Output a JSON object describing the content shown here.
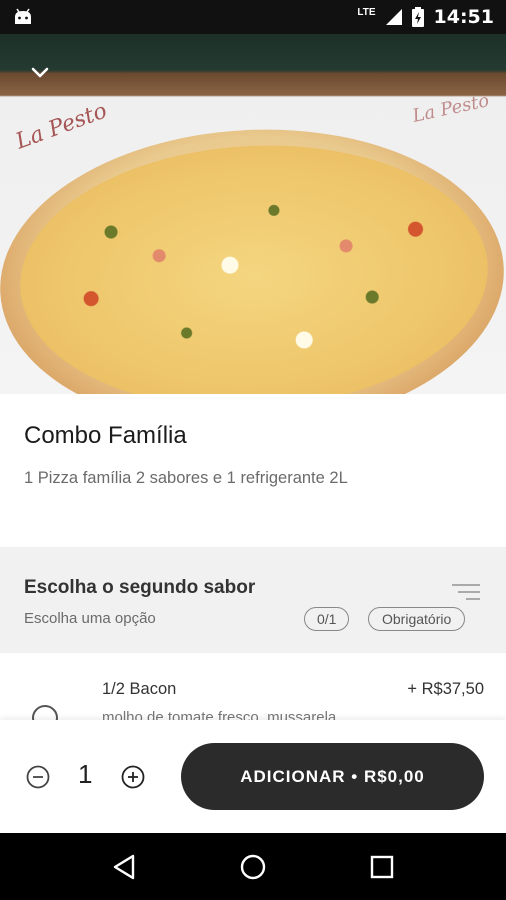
{
  "status_bar": {
    "network": "LTE",
    "time": "14:51"
  },
  "hero": {
    "logo_left": "La Pesto",
    "logo_right": "La Pesto"
  },
  "product": {
    "title": "Combo Família",
    "description": "1 Pizza família 2 sabores e 1 refrigerante 2L"
  },
  "section": {
    "title": "Escolha o segundo sabor",
    "subtitle": "Escolha uma opção",
    "count_badge": "0/1",
    "required_badge": "Obrigatório"
  },
  "options": [
    {
      "name": "1/2 Bacon",
      "price": "+ R$37,50",
      "description": "molho de tomate fresco, mussarela"
    }
  ],
  "footer": {
    "quantity": "1",
    "add_label": "ADICIONAR • R$0,00"
  },
  "colors": {
    "button_bg": "#2b2b2b",
    "section_bg": "#f1f1f1"
  }
}
